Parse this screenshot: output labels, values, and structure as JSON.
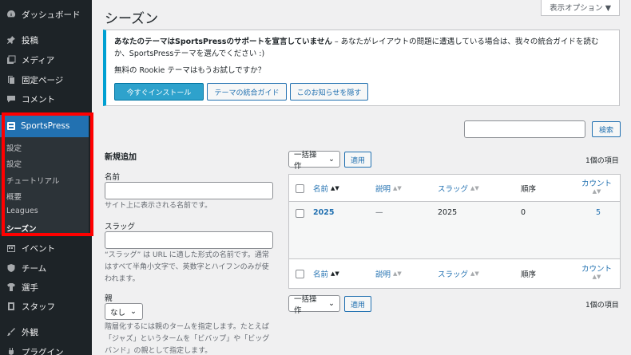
{
  "sidebar": {
    "items_top": [
      {
        "label": "ダッシュボード",
        "icon": "dashboard-icon"
      },
      {
        "label": "投稿",
        "icon": "pin-icon"
      },
      {
        "label": "メディア",
        "icon": "media-icon"
      },
      {
        "label": "固定ページ",
        "icon": "page-icon"
      },
      {
        "label": "コメント",
        "icon": "comment-icon"
      }
    ],
    "sportspress": {
      "label": "SportsPress",
      "sub": [
        "設定",
        "設定",
        "チュートリアル",
        "概要",
        "Leagues",
        "シーズン"
      ]
    },
    "items_bottom": [
      {
        "label": "イベント",
        "icon": "calendar-icon"
      },
      {
        "label": "チーム",
        "icon": "shield-icon"
      },
      {
        "label": "選手",
        "icon": "shirt-icon"
      },
      {
        "label": "スタッフ",
        "icon": "badge-icon"
      },
      {
        "label": "外観",
        "icon": "brush-icon"
      },
      {
        "label": "プラグイン",
        "icon": "plugin-icon"
      }
    ]
  },
  "header": {
    "title": "シーズン",
    "screen_options": "表示オプション ▼"
  },
  "notice": {
    "bold": "あなたのテーマはSportsPressのサポートを宣言していません",
    "text": " – あなたがレイアウトの問題に遭遇している場合は、我々の統合ガイドを読むか、SportsPressテーマを選んでください :)",
    "question": "無料の Rookie テーマはもうお試しですか？",
    "buttons": [
      "今すぐインストール",
      "テーマの統合ガイド",
      "このお知らせを隠す"
    ]
  },
  "search": {
    "button": "検索"
  },
  "form": {
    "heading": "新規追加",
    "name_label": "名前",
    "name_desc": "サイト上に表示される名前です。",
    "slug_label": "スラッグ",
    "slug_desc": "“スラッグ” は URL に適した形式の名前です。通常はすべて半角小文字で、英数字とハイフンのみが使われます。",
    "parent_label": "親",
    "parent_value": "なし",
    "parent_desc": "階層化するには親のタームを指定します。たとえば「ジャズ」というタームを「ビバップ」や「ビッグバンド」の親として指定します。"
  },
  "table": {
    "bulk_label": "一括操作",
    "apply": "適用",
    "count": "1個の項目",
    "columns": [
      "名前",
      "説明",
      "スラッグ",
      "順序",
      "カウント"
    ],
    "rows": [
      {
        "name": "2025",
        "description": "—",
        "slug": "2025",
        "order": "0",
        "count": "5"
      }
    ]
  },
  "colors": {
    "accent": "#2271b1",
    "sidebar_bg": "#1d2327",
    "highlight": "#ff0000"
  }
}
